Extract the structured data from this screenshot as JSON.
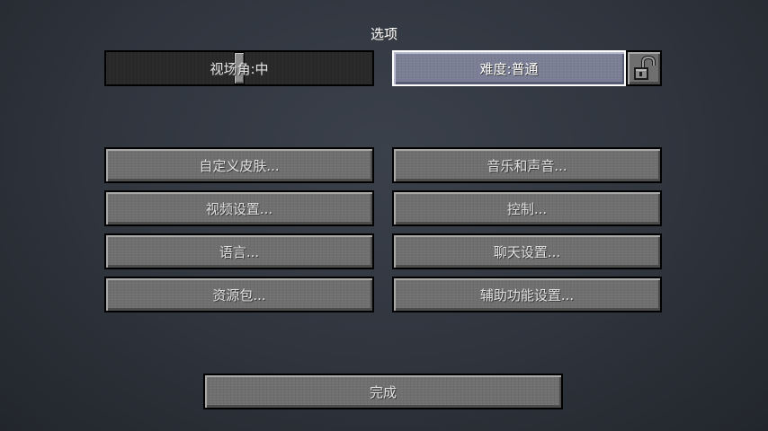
{
  "screen": {
    "title": "选项"
  },
  "top_row": {
    "fov": {
      "label": "视场角:中",
      "value_fraction": 0.5
    },
    "difficulty": {
      "label": "难度:普通"
    },
    "difficulty_lock": {
      "icon": "unlocked-padlock-icon",
      "locked": false
    }
  },
  "buttons": {
    "skin": "自定义皮肤...",
    "music": "音乐和声音...",
    "video": "视频设置...",
    "controls": "控制...",
    "language": "语言...",
    "chat": "聊天设置...",
    "resource_packs": "资源包...",
    "accessibility": "辅助功能设置..."
  },
  "done": "完成",
  "colors": {
    "button_face": "#6f6f6f",
    "button_highlight_border": "#ffffff",
    "slider_track": "#282828",
    "text": "#e0e0e0"
  }
}
